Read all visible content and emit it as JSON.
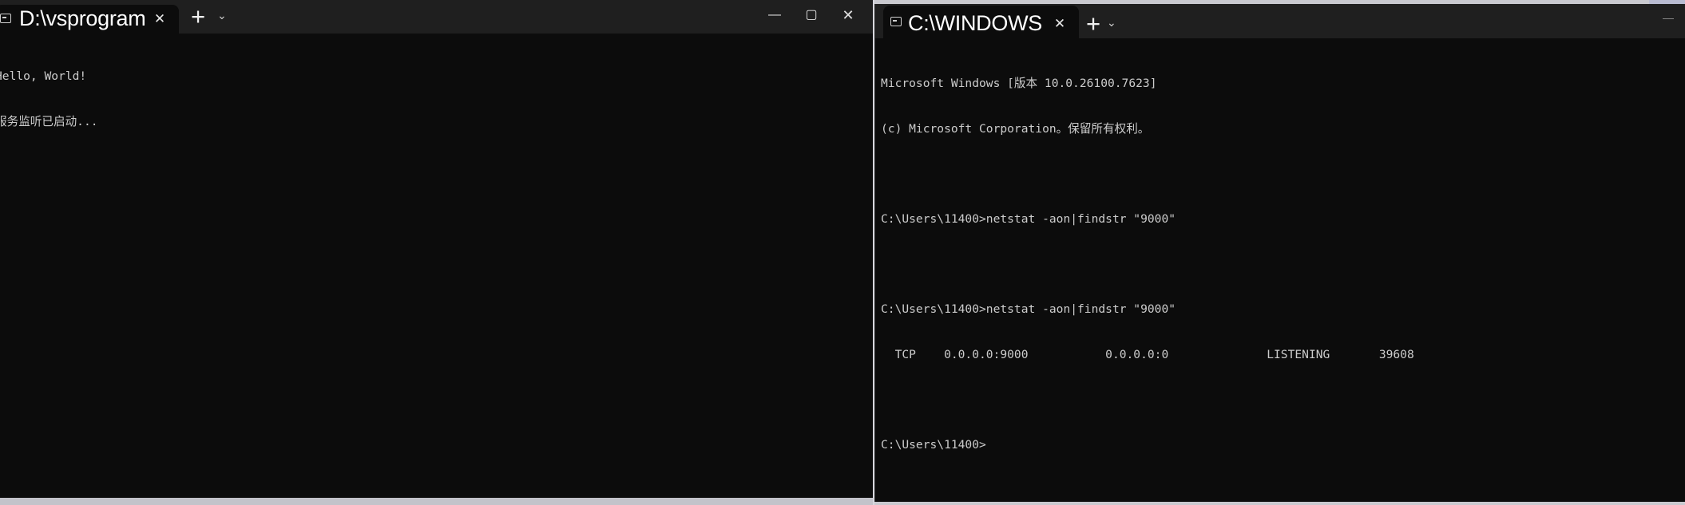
{
  "left_window": {
    "tab_title": "D:\\vsprogram\\",
    "tab_close": "✕",
    "new_tab": "+",
    "dropdown": "⌄",
    "minimize": "—",
    "maximize": "▢",
    "close": "✕",
    "lines": [
      "Hello, World!",
      "服务监听已启动..."
    ]
  },
  "right_window": {
    "tab_title": "C:\\WINDOWS",
    "tab_close": "✕",
    "new_tab": "+",
    "dropdown": "⌄",
    "minimize": "—",
    "lines": [
      "Microsoft Windows [版本 10.0.26100.7623]",
      "(c) Microsoft Corporation。保留所有权利。",
      "",
      "C:\\Users\\11400>netstat -aon|findstr \"9000\"",
      "",
      "C:\\Users\\11400>netstat -aon|findstr \"9000\"",
      "  TCP    0.0.0.0:9000           0.0.0.0:0              LISTENING       39608",
      "",
      "C:\\Users\\11400>"
    ]
  },
  "colors": {
    "terminal_bg": "#0c0c0c",
    "titlebar_bg": "#1f1f1f",
    "text": "#cccccc"
  }
}
